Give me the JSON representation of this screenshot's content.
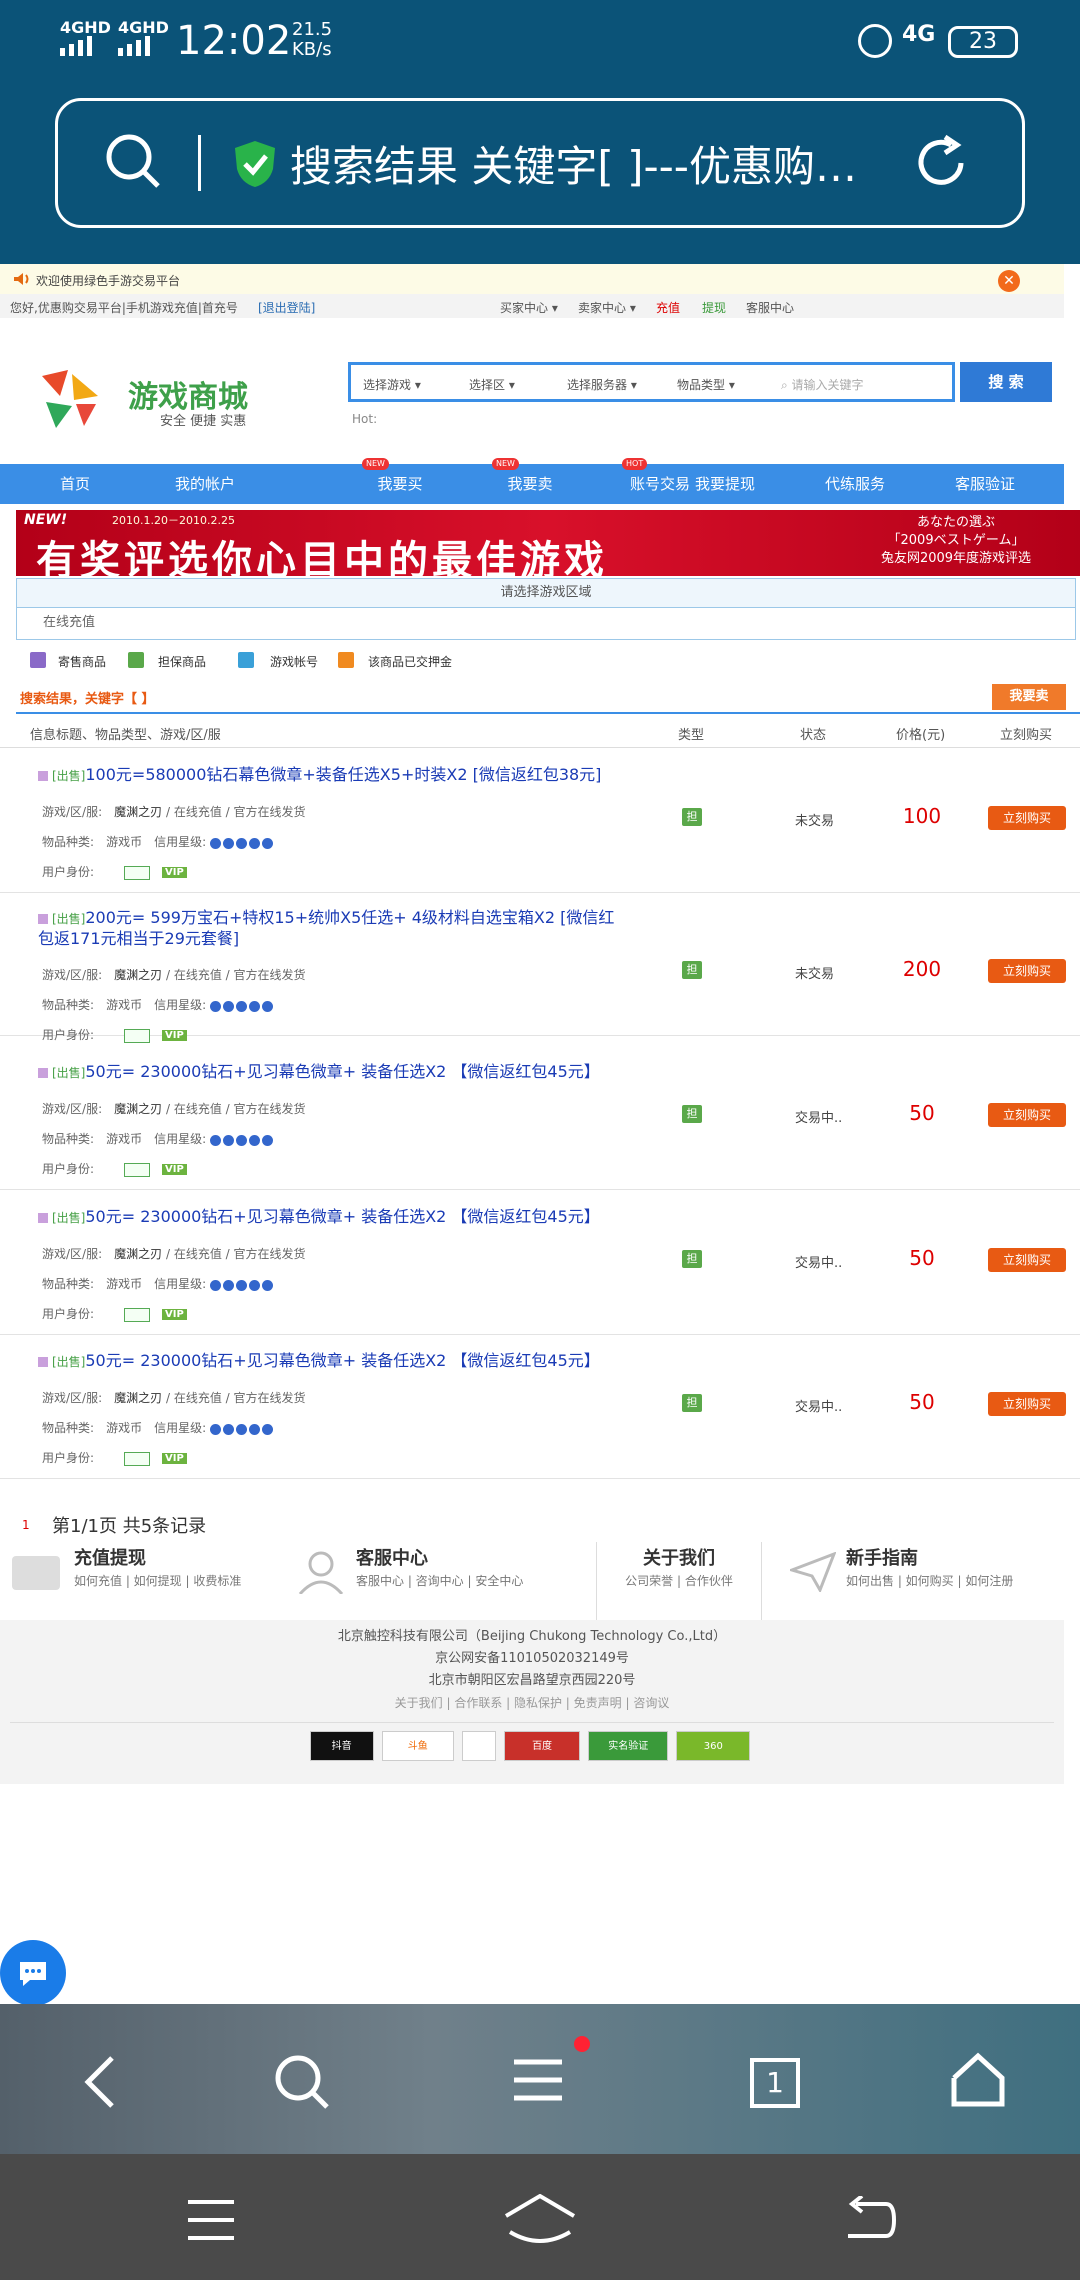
{
  "status": {
    "signal1": "4GHD",
    "signal2": "4GHD",
    "time": "12:02",
    "speed_value": "21.5",
    "speed_unit": "KB/s",
    "network": "4G",
    "battery": "23"
  },
  "browser": {
    "url_text": "搜索结果 关键字[ ]---优惠购…"
  },
  "notice": {
    "text": "欢迎使用绿色手游交易平台"
  },
  "toplinks": {
    "left": "您好,优惠购交易平台|手机游戏充值|首充号",
    "logout": "[退出登陆]",
    "buyer": "买家中心",
    "seller": "卖家中心",
    "recharge": "充值",
    "withdraw": "提现",
    "service": "客服中心"
  },
  "logo": {
    "title": "游戏商城",
    "slogan": "安全 便捷 实惠"
  },
  "search": {
    "game": "选择游戏",
    "area": "选择区",
    "server": "选择服务器",
    "type": "物品类型",
    "placeholder": "请输入关键字",
    "button": "搜 索",
    "hot": "Hot:"
  },
  "nav": {
    "items": [
      "首页",
      "我的帐户",
      "我要买",
      "我要卖",
      "账号交易",
      "我要提现",
      "代练服务",
      "客服验证"
    ],
    "badge_new": "NEW",
    "badge_hot": "HOT"
  },
  "banner": {
    "new_label": "NEW!",
    "date": "2010.1.20－2010.2.25",
    "main_text": "有奖评选你心目中的最佳游戏",
    "jp_line1": "あなたの選ぶ",
    "jp_line2": "「2009ベストゲーム」",
    "jp_line3": "兔友网2009年度游戏评选"
  },
  "zone": {
    "label": "请选择游戏区域",
    "recharge": "在线充值"
  },
  "legend": {
    "items": [
      "寄售商品",
      "担保商品",
      "游戏帐号",
      "该商品已交押金"
    ]
  },
  "results": {
    "title": "搜索结果，关键字【 】",
    "btn": "我要卖"
  },
  "table": {
    "headers": [
      "信息标题、物品类型、游戏/区/服",
      "类型",
      "状态",
      "价格(元)",
      "立刻购买"
    ],
    "rows": [
      {
        "tag": "[出售]",
        "title": "100元=580000钻石幕色微章+装备任选X5+时装X2 [微信返红包38元]",
        "game_label": "游戏/区/服:",
        "game": "魔渊之刃",
        "sep": " / ",
        "channel": "在线充值 / 官方在线发货",
        "item_label": "物品种类:",
        "item": "游戏币",
        "credit_label": "信用星级:",
        "user_label": "用户身份:",
        "status": "未交易",
        "price": "100",
        "buy": "立刻购买"
      },
      {
        "tag": "[出售]",
        "title": "200元= 599万宝石+特权15+统帅X5任选+ 4级材料自选宝箱X2 [微信红包返171元相当于29元套餐]",
        "game_label": "游戏/区/服:",
        "game": "魔渊之刃",
        "sep": " / ",
        "channel": "在线充值 / 官方在线发货",
        "item_label": "物品种类:",
        "item": "游戏币",
        "credit_label": "信用星级:",
        "user_label": "用户身份:",
        "status": "未交易",
        "price": "200",
        "buy": "立刻购买"
      },
      {
        "tag": "[出售]",
        "title": "50元= 230000钻石+见习幕色微章+ 装备任选X2 【微信返红包45元】",
        "game_label": "游戏/区/服:",
        "game": "魔渊之刃",
        "sep": " / ",
        "channel": "在线充值 / 官方在线发货",
        "item_label": "物品种类:",
        "item": "游戏币",
        "credit_label": "信用星级:",
        "user_label": "用户身份:",
        "status": "交易中..",
        "price": "50",
        "buy": "立刻购买"
      },
      {
        "tag": "[出售]",
        "title": "50元= 230000钻石+见习幕色微章+ 装备任选X2 【微信返红包45元】",
        "game_label": "游戏/区/服:",
        "game": "魔渊之刃",
        "sep": " / ",
        "channel": "在线充值 / 官方在线发货",
        "item_label": "物品种类:",
        "item": "游戏币",
        "credit_label": "信用星级:",
        "user_label": "用户身份:",
        "status": "交易中..",
        "price": "50",
        "buy": "立刻购买"
      },
      {
        "tag": "[出售]",
        "title": "50元= 230000钻石+见习幕色微章+ 装备任选X2 【微信返红包45元】",
        "game_label": "游戏/区/服:",
        "game": "魔渊之刃",
        "sep": " / ",
        "channel": "在线充值 / 官方在线发货",
        "item_label": "物品种类:",
        "item": "游戏币",
        "credit_label": "信用星级:",
        "user_label": "用户身份:",
        "status": "交易中..",
        "price": "50",
        "buy": "立刻购买"
      }
    ],
    "type_icon": "担",
    "vip": "VIP"
  },
  "pager": {
    "num": "1",
    "text": "第1/1页 共5条记录"
  },
  "help": {
    "c1_title": "充值提现",
    "c1_links": "如何充值 | 如何提现 | 收费标准",
    "c2_title": "客服中心",
    "c2_links": "客服中心 | 咨询中心 | 安全中心",
    "c3_title": "关于我们",
    "c3_links": "公司荣誉 | 合作伙伴",
    "c4_title": "新手指南",
    "c4_links": "如何出售 | 如何购买 | 如何注册"
  },
  "footer": {
    "company": "北京触控科技有限公司（Beijing Chukong Technology Co.,Ltd）",
    "icp": "京公网安备11010502032149号",
    "address": "北京市朝阳区宏昌路望京西园220号",
    "links": "关于我们 | 合作联系 | 隐私保护 | 免责声明 | 咨询议",
    "badges": [
      "抖音",
      "斗鱼",
      "",
      "百度",
      "实名验证",
      "360"
    ]
  },
  "bottom": {
    "tab_count": "1"
  },
  "colors": {
    "status_bar": "#0b5378",
    "nav": "#3a8ee6",
    "buy_button": "#e85a13",
    "price": "#d00",
    "title_link": "#1a3bb5"
  }
}
